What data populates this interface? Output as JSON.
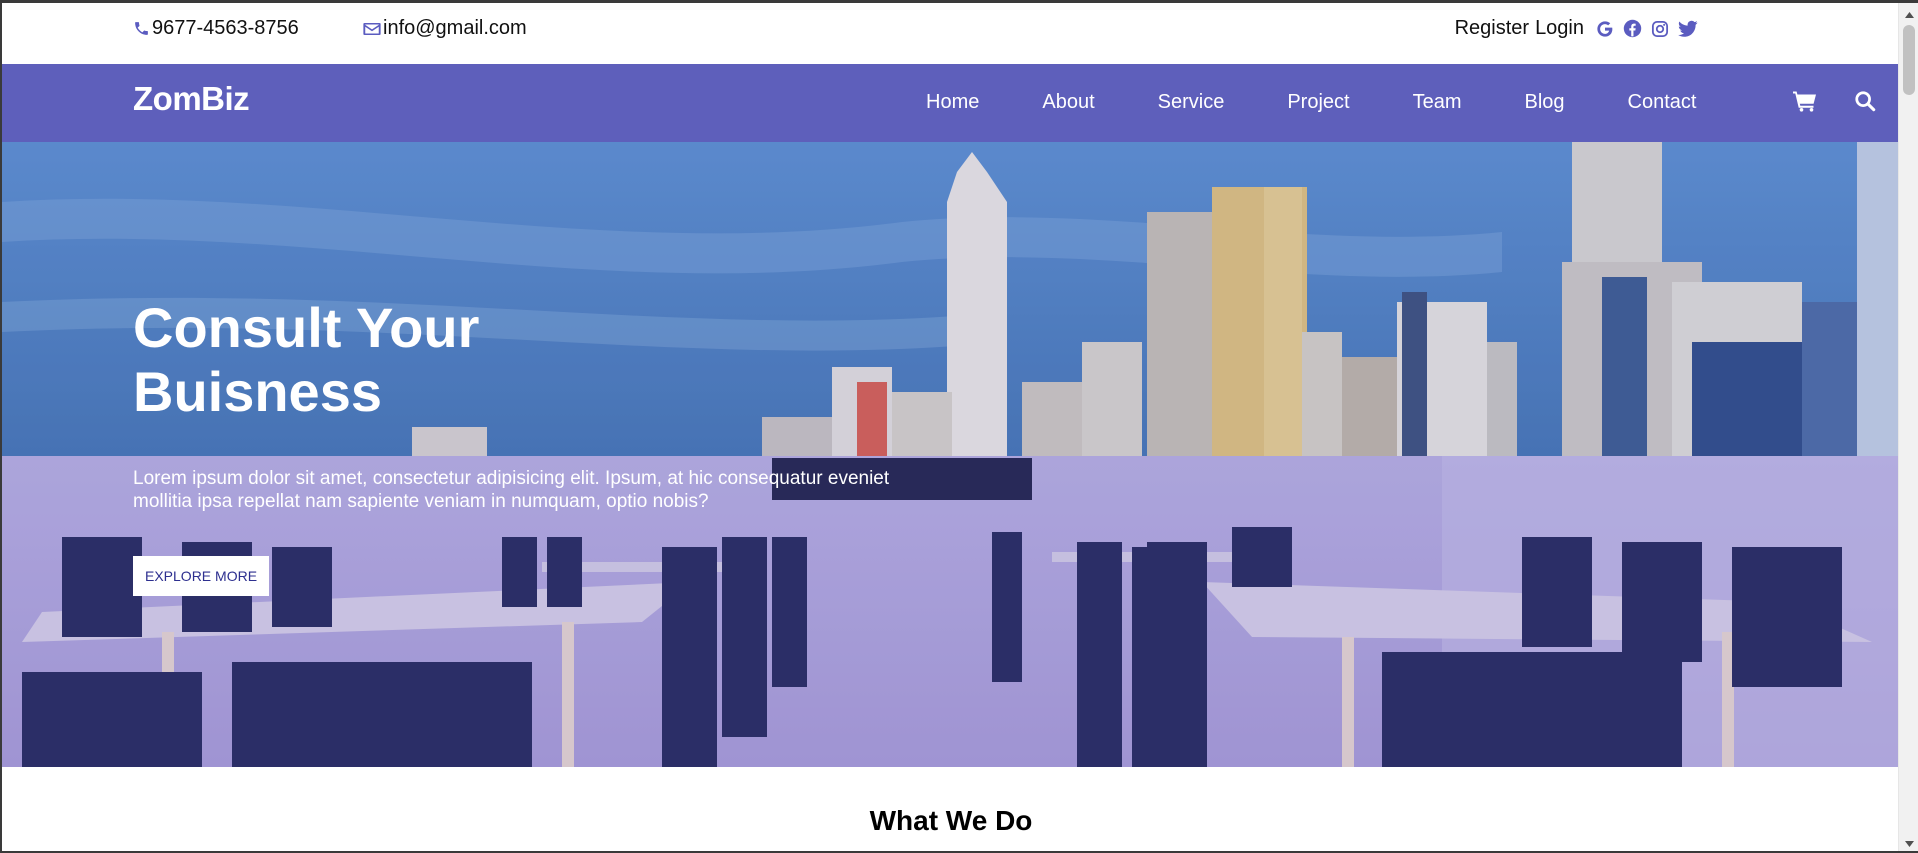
{
  "topbar": {
    "phone": "9677-4563-8756",
    "email": "info@gmail.com",
    "register_label": "Register",
    "login_label": "Login",
    "social_icons": [
      "google-icon",
      "facebook-icon",
      "instagram-icon",
      "twitter-icon"
    ]
  },
  "navbar": {
    "logo": "ZomBiz",
    "items": [
      {
        "label": "Home"
      },
      {
        "label": "About"
      },
      {
        "label": "Service"
      },
      {
        "label": "Project"
      },
      {
        "label": "Team"
      },
      {
        "label": "Blog"
      },
      {
        "label": "Contact"
      }
    ],
    "icons": [
      "cart-icon",
      "search-icon"
    ]
  },
  "hero": {
    "title_line1": "Consult Your",
    "title_line2": "Buisness",
    "text": "Lorem ipsum dolor sit amet, consectetur adipisicing elit. Ipsum, at hic consequatur eveniet mollitia ipsa repellat nam sapiente veniam in numquam, optio nobis?",
    "button_label": "EXPLORE MORE"
  },
  "section": {
    "title": "What We Do"
  },
  "colors": {
    "brand": "#5e5fbb",
    "icon_accent": "#5b5cc0",
    "sky": "#4e7fc0",
    "overlay": "#b6a9e0"
  }
}
